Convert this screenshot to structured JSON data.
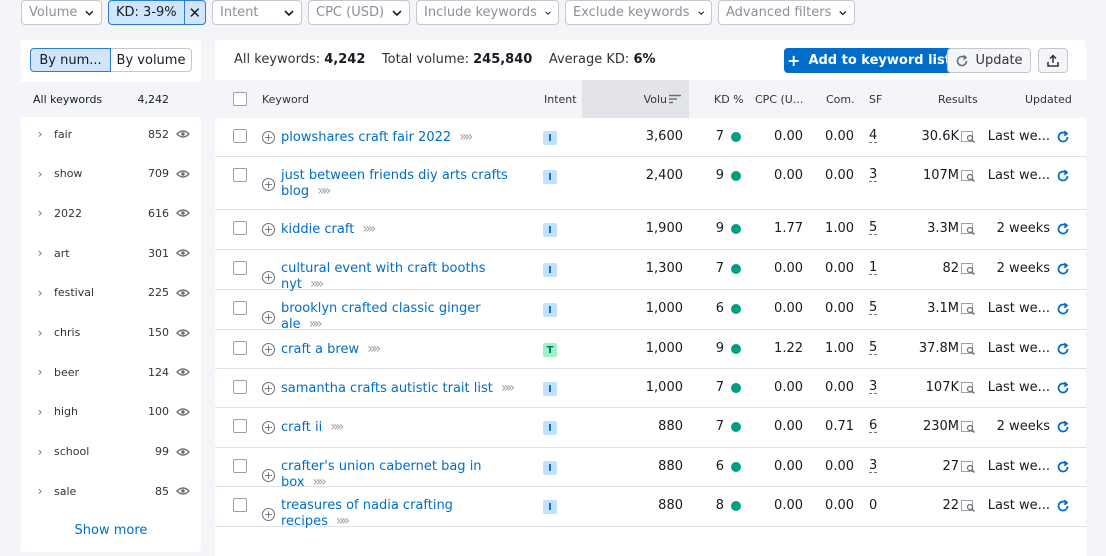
{
  "filters": {
    "volume": "Volume",
    "kd": "KD: 3-9%",
    "intent": "Intent",
    "cpc": "CPC (USD)",
    "include": "Include keywords",
    "exclude": "Exclude keywords",
    "advanced": "Advanced filters"
  },
  "sidebar": {
    "by_number": "By num...",
    "by_volume": "By volume",
    "all_keywords_label": "All keywords",
    "all_keywords_count": "4,242",
    "groups": [
      {
        "name": "fair",
        "count": "852"
      },
      {
        "name": "show",
        "count": "709"
      },
      {
        "name": "2022",
        "count": "616"
      },
      {
        "name": "art",
        "count": "301"
      },
      {
        "name": "festival",
        "count": "225"
      },
      {
        "name": "chris",
        "count": "150"
      },
      {
        "name": "beer",
        "count": "124"
      },
      {
        "name": "high",
        "count": "100"
      },
      {
        "name": "school",
        "count": "99"
      },
      {
        "name": "sale",
        "count": "85"
      }
    ],
    "show_more": "Show more"
  },
  "summary": {
    "all_keywords_label": "All keywords:",
    "all_keywords_value": "4,242",
    "total_volume_label": "Total volume:",
    "total_volume_value": "245,840",
    "avg_kd_label": "Average KD:",
    "avg_kd_value": "6%"
  },
  "buttons": {
    "add_to_list": "Add to keyword list",
    "update": "Update"
  },
  "columns": {
    "keyword": "Keyword",
    "intent": "Intent",
    "volume": "Volu",
    "kd": "KD %",
    "cpc": "CPC (U...",
    "com": "Com.",
    "sf": "SF",
    "results": "Results",
    "updated": "Updated"
  },
  "rows": [
    {
      "keyword": "plowshares craft fair 2022",
      "intent": "I",
      "volume": "3,600",
      "kd": "7",
      "cpc": "0.00",
      "com": "0.00",
      "sf": "4",
      "results": "30.6K",
      "updated": "Last we..."
    },
    {
      "keyword": "just between friends diy arts crafts blog",
      "intent": "I",
      "volume": "2,400",
      "kd": "9",
      "cpc": "0.00",
      "com": "0.00",
      "sf": "3",
      "results": "107M",
      "updated": "Last we..."
    },
    {
      "keyword": "kiddie craft",
      "intent": "I",
      "volume": "1,900",
      "kd": "9",
      "cpc": "1.77",
      "com": "1.00",
      "sf": "5",
      "results": "3.3M",
      "updated": "2 weeks"
    },
    {
      "keyword": "cultural event with craft booths nyt",
      "intent": "I",
      "volume": "1,300",
      "kd": "7",
      "cpc": "0.00",
      "com": "0.00",
      "sf": "1",
      "results": "82",
      "updated": "2 weeks"
    },
    {
      "keyword": "brooklyn crafted classic ginger ale",
      "intent": "I",
      "volume": "1,000",
      "kd": "6",
      "cpc": "0.00",
      "com": "0.00",
      "sf": "5",
      "results": "3.1M",
      "updated": "Last we..."
    },
    {
      "keyword": "craft a brew",
      "intent": "T",
      "volume": "1,000",
      "kd": "9",
      "cpc": "1.22",
      "com": "1.00",
      "sf": "5",
      "results": "37.8M",
      "updated": "Last we..."
    },
    {
      "keyword": "samantha crafts autistic trait list",
      "intent": "I",
      "volume": "1,000",
      "kd": "7",
      "cpc": "0.00",
      "com": "0.00",
      "sf": "3",
      "results": "107K",
      "updated": "Last we..."
    },
    {
      "keyword": "craft ii",
      "intent": "I",
      "volume": "880",
      "kd": "7",
      "cpc": "0.00",
      "com": "0.71",
      "sf": "6",
      "results": "230M",
      "updated": "2 weeks"
    },
    {
      "keyword": "crafter's union cabernet bag in box",
      "intent": "I",
      "volume": "880",
      "kd": "6",
      "cpc": "0.00",
      "com": "0.00",
      "sf": "3",
      "results": "27",
      "updated": "Last we..."
    },
    {
      "keyword": "treasures of nadia crafting recipes",
      "intent": "I",
      "volume": "880",
      "kd": "8",
      "cpc": "0.00",
      "com": "0.00",
      "sf": "0",
      "results": "22",
      "updated": "Last we..."
    }
  ],
  "colors": {
    "accent": "#006dca",
    "kd_dot": "#009f81",
    "intent_info": "#c2e0ff",
    "intent_transactional": "#9ef2c9"
  }
}
